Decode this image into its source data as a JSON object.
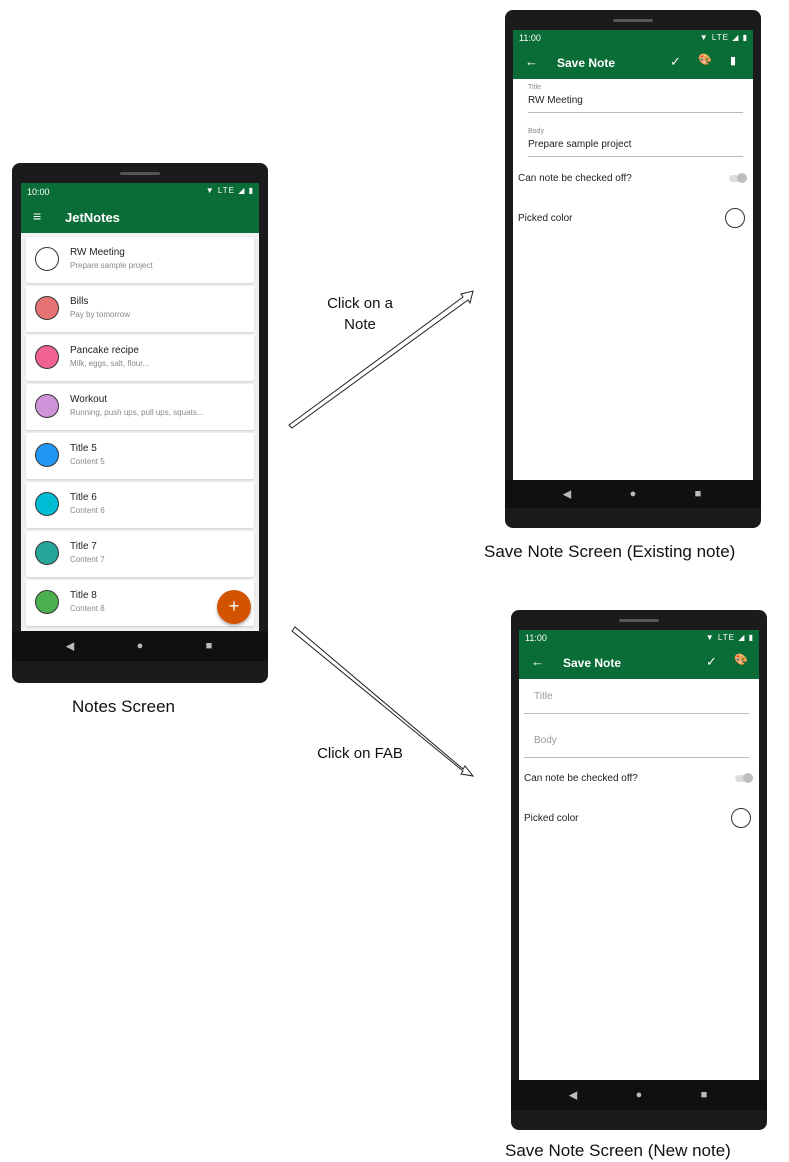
{
  "notes_screen": {
    "time": "10:00",
    "status_icons": "▼ LTE ◢ ▮",
    "menu_icon": "menu-icon",
    "title": "JetNotes",
    "app_bar_color": "#0a6c36",
    "notes": [
      {
        "title": "RW Meeting",
        "content": "Prepare sample project",
        "color": "#ffffff"
      },
      {
        "title": "Bills",
        "content": "Pay by tomorrow",
        "color": "#e57373"
      },
      {
        "title": "Pancake recipe",
        "content": "Milk, eggs, salt, flour...",
        "color": "#f06292"
      },
      {
        "title": "Workout",
        "content": "Running, push ups, pull ups, squats...",
        "color": "#ce93d8"
      },
      {
        "title": "Title 5",
        "content": "Content 5",
        "color": "#2196f3"
      },
      {
        "title": "Title 6",
        "content": "Content 6",
        "color": "#00bcd4"
      },
      {
        "title": "Title 7",
        "content": "Content 7",
        "color": "#26a69a"
      },
      {
        "title": "Title 8",
        "content": "Content 8",
        "color": "#4caf50"
      }
    ],
    "fab_label": "+",
    "fab_color": "#d35400",
    "caption": "Notes Screen"
  },
  "save_existing": {
    "time": "11:00",
    "status_icons": "▼ LTE ◢ ▮",
    "title": "Save Note",
    "title_label": "Title",
    "title_value": "RW Meeting",
    "body_label": "Body",
    "body_value": "Prepare sample project",
    "checkable_label": "Can note be checked off?",
    "color_label": "Picked color",
    "caption": "Save Note Screen (Existing note)"
  },
  "save_new": {
    "time": "11:00",
    "status_icons": "▼ LTE ◢ ▮",
    "title": "Save Note",
    "title_placeholder": "Title",
    "body_placeholder": "Body",
    "checkable_label": "Can note be checked off?",
    "color_label": "Picked color",
    "caption": "Save Note Screen (New note)"
  },
  "arrows": {
    "click_note_line1": "Click on a",
    "click_note_line2": "Note",
    "click_fab": "Click on FAB"
  },
  "glyphs": {
    "back": "←",
    "check": "✓",
    "palette": "🎨",
    "trash": "▮",
    "menu": "≡",
    "nav_back": "◀",
    "nav_home": "●",
    "nav_recent": "■"
  }
}
